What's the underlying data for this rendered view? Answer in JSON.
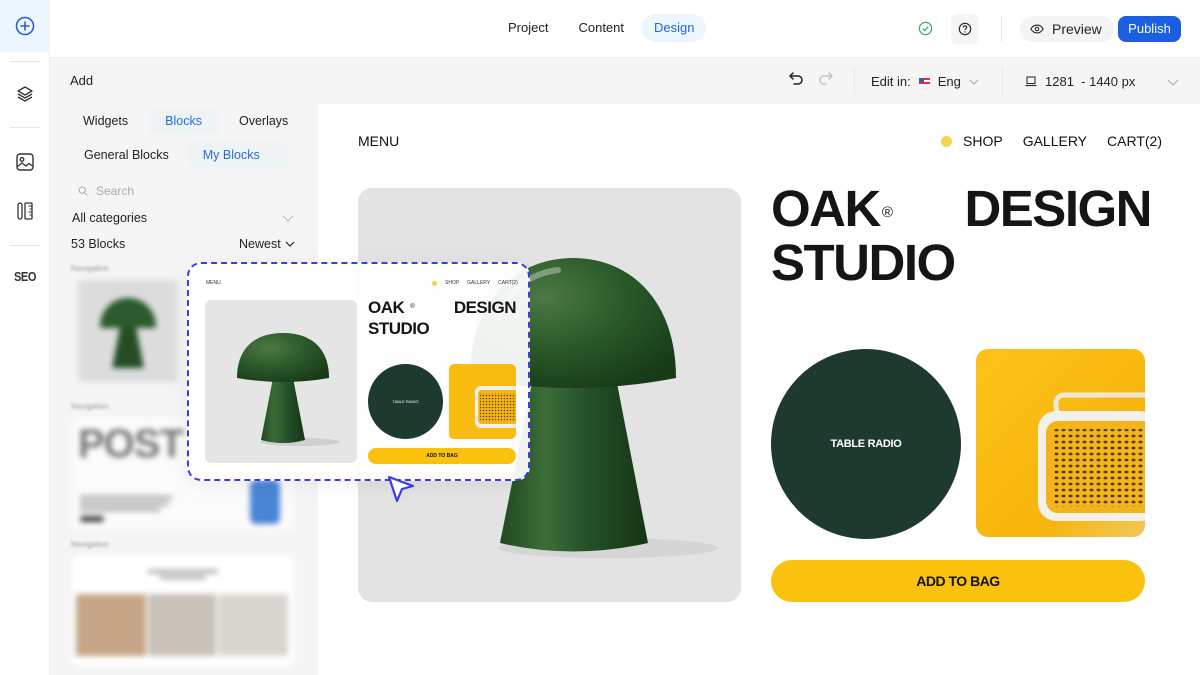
{
  "rail": {
    "items": [
      {
        "icon": "plus-circle-icon",
        "label": "Add",
        "active": true
      },
      {
        "icon": "layers-icon",
        "label": "Layers"
      },
      {
        "icon": "image-icon",
        "label": "Media"
      },
      {
        "icon": "design-tools-icon",
        "label": "Design tools"
      },
      {
        "icon": "seo-icon",
        "label": "SEO"
      }
    ],
    "seo_label": "SEO"
  },
  "topbar": {
    "tabs": [
      {
        "label": "Project",
        "active": false
      },
      {
        "label": "Content",
        "active": false
      },
      {
        "label": "Design",
        "active": true
      }
    ],
    "preview_label": "Preview",
    "publish_label": "Publish",
    "accent_color": "#1a5fe0"
  },
  "subbar": {
    "panel_title": "Add",
    "edit_in_label": "Edit in:",
    "language": "Eng",
    "breakpoint": "1281  - 1440 px"
  },
  "panel": {
    "tabs": [
      {
        "label": "Widgets",
        "active": false
      },
      {
        "label": "Blocks",
        "active": true
      },
      {
        "label": "Overlays",
        "active": false
      }
    ],
    "subtabs": [
      {
        "label": "General Blocks",
        "active": false
      },
      {
        "label": "My Blocks",
        "active": true
      }
    ],
    "search_placeholder": "Search",
    "category": "All categories",
    "count": "53 Blocks",
    "sort": "Newest",
    "blocks": [
      {
        "label": "Navigation"
      },
      {
        "label": "Navigation",
        "headline": "POST"
      },
      {
        "label": "Navigation"
      }
    ]
  },
  "site": {
    "menu": "MENU",
    "nav": [
      "SHOP",
      "GALLERY",
      "CART(2)"
    ],
    "title_line1_a": "OAK",
    "title_registered": "®",
    "title_line1_b": "DESIGN",
    "title_line2": "STUDIO",
    "circle_label": "TABLE RADIO",
    "cta": "ADD TO BAG",
    "colors": {
      "dark_green": "#1e3a2f",
      "yellow": "#fac20f",
      "dot": "#f5d34e"
    }
  },
  "drag_preview": {
    "menu": "MENU",
    "nav": [
      "SHOP",
      "GALLERY",
      "CART(2)"
    ],
    "title_line1_a": "OAK",
    "title_registered": "®",
    "title_line1_b": "DESIGN",
    "title_line2": "STUDIO",
    "circle_label": "TABLE RADIO",
    "cta": "ADD TO BAG"
  }
}
